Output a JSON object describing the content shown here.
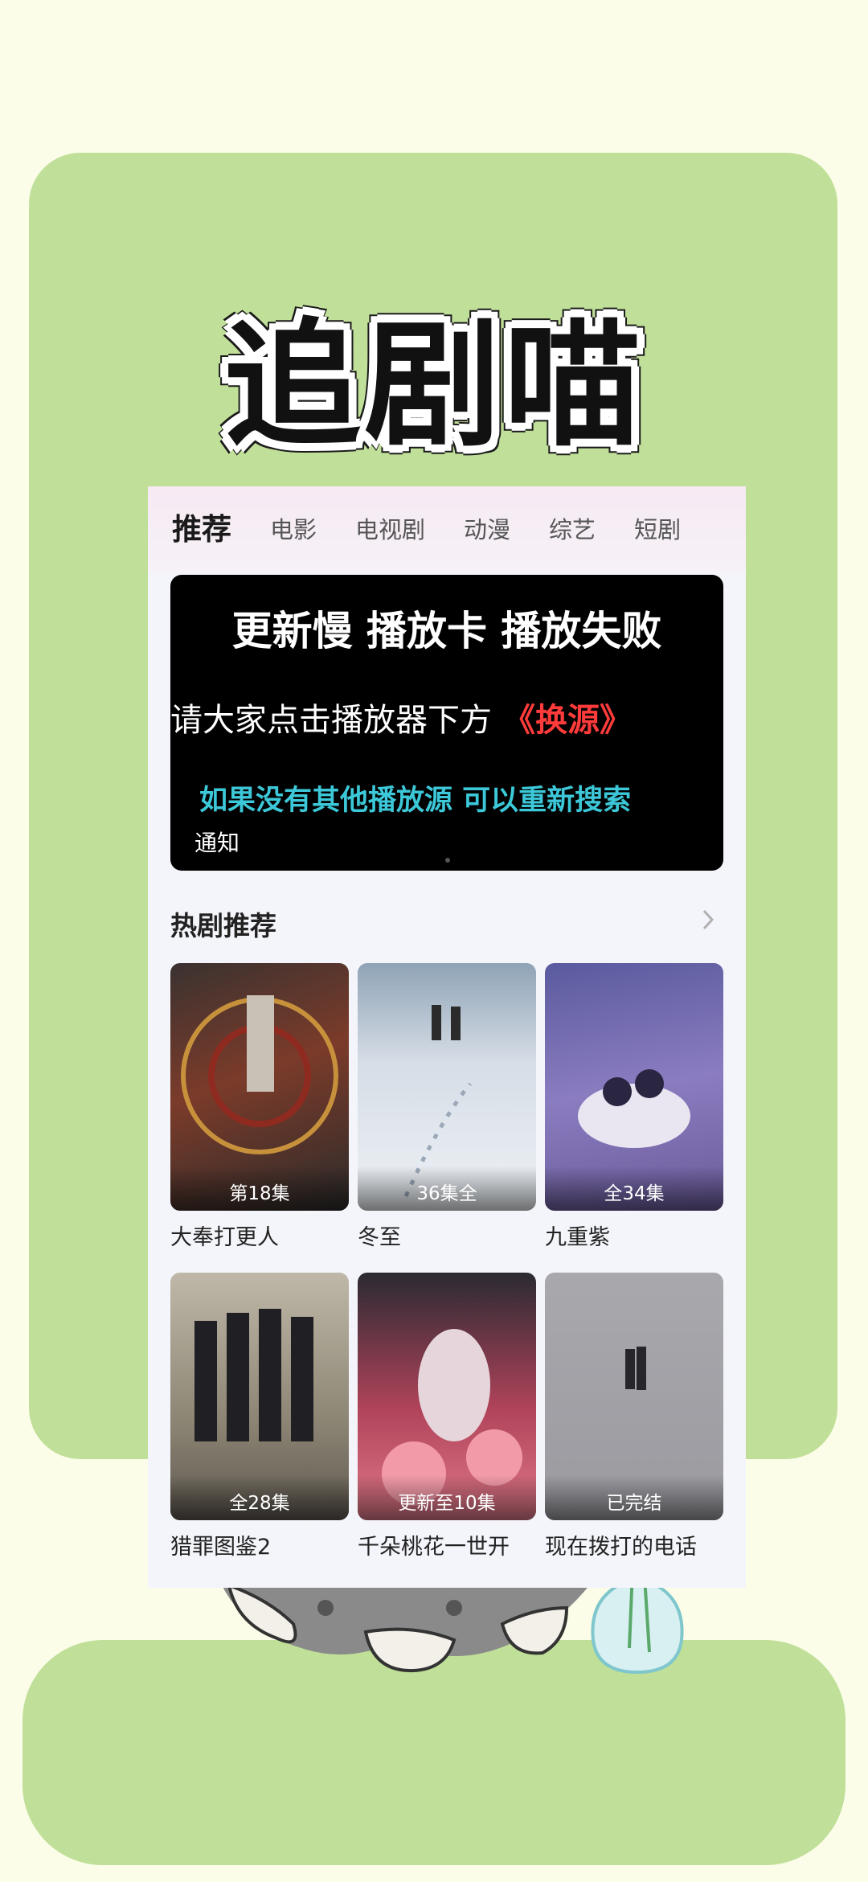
{
  "brand": {
    "title": "追剧喵"
  },
  "tabs": [
    {
      "label": "推荐",
      "active": true
    },
    {
      "label": "电影"
    },
    {
      "label": "电视剧"
    },
    {
      "label": "动漫"
    },
    {
      "label": "综艺"
    },
    {
      "label": "短剧"
    }
  ],
  "banner": {
    "line1": "更新慢 播放卡 播放失败",
    "line2_text": "请大家点击播放器下方",
    "line2_highlight": "《换源》",
    "line3": "如果没有其他播放源 可以重新搜索",
    "caption": "通知"
  },
  "section": {
    "title": "热剧推荐"
  },
  "shows": [
    {
      "title": "大奉打更人",
      "badge": "第18集",
      "tone": "#7b3b2a"
    },
    {
      "title": "冬至",
      "badge": "36集全",
      "tone": "#c8d4e2"
    },
    {
      "title": "九重紫",
      "badge": "全34集",
      "tone": "#7e6fb4"
    },
    {
      "title": "猎罪图鉴2",
      "badge": "全28集",
      "tone": "#6a6254"
    },
    {
      "title": "千朵桃花一世开",
      "badge": "更新至10集",
      "tone": "#b0435a"
    },
    {
      "title": "现在拨打的电话",
      "badge": "已完结",
      "tone": "#9a9aa0"
    }
  ],
  "colors": {
    "page_bg": "#fbfde8",
    "card_green": "#c0df98",
    "banner_red": "#ff3b3b",
    "banner_cyan": "#3cc8d8"
  }
}
